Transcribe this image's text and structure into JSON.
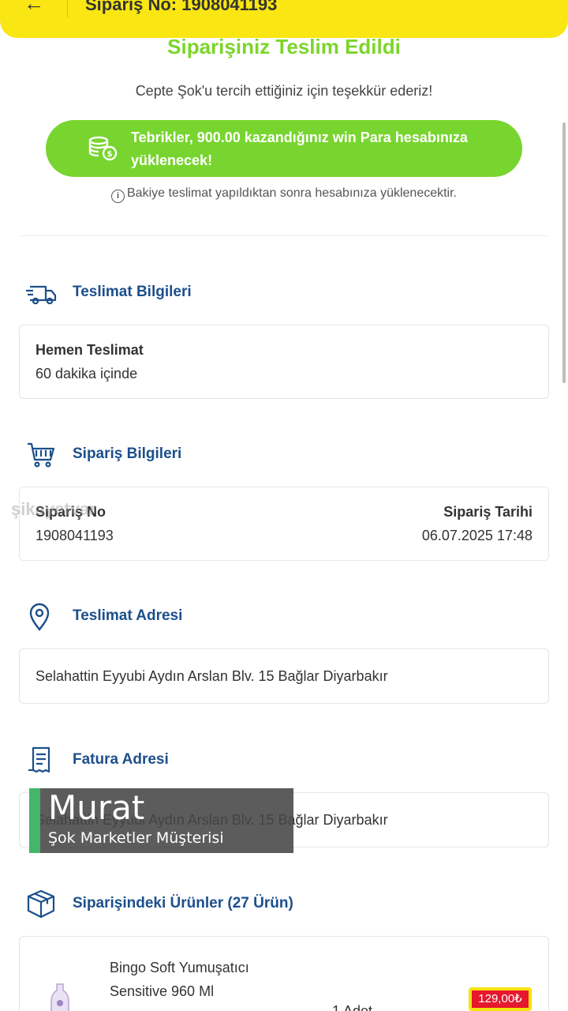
{
  "header": {
    "back_icon": "arrow-left-icon",
    "title": "Sipariş No: 1908041193"
  },
  "status": {
    "heading": "Siparişiniz Teslim Edildi",
    "thanks": "Cepte Şok'u tercih ettiğiniz için teşekkür ederiz!",
    "reward_text": "Tebrikler, 900.00 kazandığınız win Para hesabınıza yüklenecek!",
    "note": "Bakiye teslimat yapıldıktan sonra hesabınıza yüklenecektir."
  },
  "delivery": {
    "title": "Teslimat Bilgileri",
    "type": "Hemen Teslimat",
    "time": "60 dakika içinde"
  },
  "order": {
    "title": "Sipariş Bilgileri",
    "no_label": "Sipariş No",
    "no_value": "1908041193",
    "date_label": "Sipariş Tarihi",
    "date_value": "06.07.2025 17:48"
  },
  "address": {
    "title": "Teslimat Adresi",
    "value": "Selahattin Eyyubi Aydın Arslan Blv. 15 Bağlar Diyarbakır"
  },
  "invoice": {
    "title": "Fatura Adresi",
    "value": "Selahattin Eyyubi Aydın Arslan Blv. 15 Bağlar Diyarbakır"
  },
  "products": {
    "title": "Siparişindeki Ürünler (27 Ürün)",
    "items": [
      {
        "name": "Bingo Soft Yumuşatıcı Sensitive 960 Ml",
        "qty": "1 Adet",
        "price": "129,00₺"
      }
    ]
  },
  "watermark": "şikayetvar",
  "overlay": {
    "name": "Murat",
    "subtitle": "Şok Marketler Müşterisi"
  },
  "colors": {
    "brand_yellow": "#f9e612",
    "success_green": "#7cd52a",
    "title_blue": "#1c4f8c",
    "price_red": "#e5182d"
  }
}
